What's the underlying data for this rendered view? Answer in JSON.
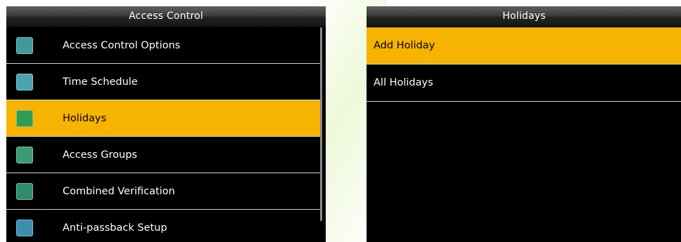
{
  "left_panel": {
    "title": "Access Control",
    "items": [
      {
        "label": "Access Control Options",
        "icon": "door-options-icon",
        "icon_color": "#3f9a9f",
        "selected": false
      },
      {
        "label": "Time Schedule",
        "icon": "clock-settings-icon",
        "icon_color": "#4aa3b5",
        "selected": false
      },
      {
        "label": "Holidays",
        "icon": "calendar-icon",
        "icon_color": "#2f9d55",
        "selected": true
      },
      {
        "label": "Access Groups",
        "icon": "group-door-icon",
        "icon_color": "#3a9a74",
        "selected": false
      },
      {
        "label": "Combined Verification",
        "icon": "combined-verification-icon",
        "icon_color": "#2e8c6e",
        "selected": false
      },
      {
        "label": "Anti-passback Setup",
        "icon": "anti-passback-icon",
        "icon_color": "#3c8fb0",
        "selected": false
      }
    ]
  },
  "right_panel": {
    "title": "Holidays",
    "items": [
      {
        "label": "Add Holiday",
        "selected": true
      },
      {
        "label": "All Holidays",
        "selected": false
      }
    ]
  },
  "colors": {
    "highlight": "#f6b300",
    "screen_bg": "#000000",
    "divider": "#d2d2d2"
  }
}
